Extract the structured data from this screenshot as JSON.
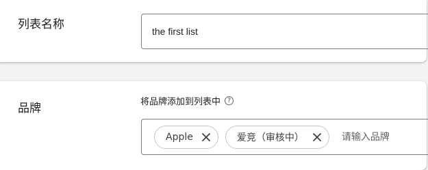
{
  "list_name": {
    "label": "列表名称",
    "value": "the first list"
  },
  "brand": {
    "label": "品牌",
    "help_text": "将品牌添加到列表中",
    "help_icon": "question-circle-icon",
    "chips": [
      {
        "label": "Apple"
      },
      {
        "label": "爱竞（审核中）"
      }
    ],
    "input_placeholder": "请输入品牌"
  }
}
